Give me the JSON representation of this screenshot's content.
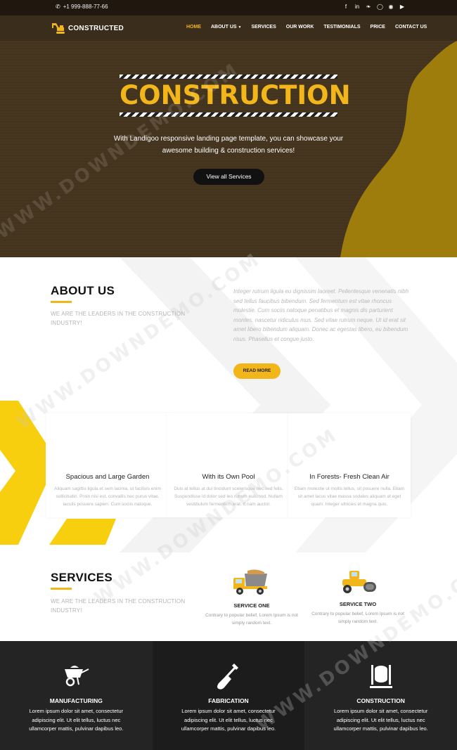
{
  "topbar": {
    "phone": "+1 999-888-77-66",
    "socials": [
      "facebook-icon",
      "linkedin-icon",
      "twitter-icon",
      "instagram-icon",
      "pinterest-icon",
      "youtube-icon"
    ]
  },
  "navbar": {
    "logo": "CONSTRUCTED",
    "items": [
      "HOME",
      "ABOUT US",
      "SERVICES",
      "OUR WORK",
      "TESTIMONIALS",
      "PRICE",
      "CONTACT US"
    ],
    "active": "HOME",
    "accent": "#f2b61a"
  },
  "hero": {
    "title": "CONSTRUCTION",
    "subtitle_line1": "With Landigoo responsive landing page template, you can showcase your",
    "subtitle_line2": "awesome building & construction services!",
    "button": "View all Services"
  },
  "about": {
    "title": "ABOUT US",
    "tagline": "WE ARE THE LEADERS IN THE CONSTRUCTION INDUSTRY!",
    "text": "Integer rutrum ligula eu dignissim laoreet. Pellentesque venenatis nibh sed tellus faucibus bibendum. Sed fermentum est vitae rhoncus molestie. Cum sociis natoque penatibus et magnis dis parturient montes, nascetur ridiculus mus. Sed vitae rutrum neque. Ut id erat sit amet libero bibendum aliquam. Donec ac egestas libero, eu bibendum risus. Phasellus et congue justo.",
    "button": "READ MORE"
  },
  "features": [
    {
      "title": "Spacious and Large Garden",
      "text": "Aliquam sagittis ligula et sem lacinia, ut facilisis enim sollicitudin. Proin nisi est, convallis nec purus vitae, iaculis posuere sapien. Cum sociis natoque."
    },
    {
      "title": "With its Own Pool",
      "text": "Duis at tellus at dui tincidunt scelerisque nec sed felis. Suspendisse id dolor sed leo rutrum euismod. Nullam vestibulum fermentum erat. It nam auctor."
    },
    {
      "title": "In Forests- Fresh Clean Air",
      "text": "Etiam molestie ut mollis tellus, sit posuere nulla. Etiam sit amet lacus vitae massa sodales aliquam at eget quam. Integer ultricies et magna quis."
    }
  ],
  "services": {
    "title": "SERVICES",
    "tagline": "WE ARE THE LEADERS IN THE CONSTRUCTION INDUSTRY!",
    "items": [
      {
        "name": "SERVICE ONE",
        "text": "Contrary to popular belief, Lorem Ipsum is not simply random text."
      },
      {
        "name": "SERVICE TWO",
        "text": "Contrary to popular belief, Lorem Ipsum is not simply random text."
      }
    ]
  },
  "band": [
    {
      "name": "MANUFACTURING",
      "text": "Lorem ipsum dolor sit amet, consectetur adipiscing elit. Ut elit tellus, luctus nec ullamcorper mattis, pulvinar dapibus leo."
    },
    {
      "name": "FABRICATION",
      "text": "Lorem ipsum dolor sit amet, consectetur adipiscing elit. Ut elit tellus, luctus nec ullamcorper mattis, pulvinar dapibus leo."
    },
    {
      "name": "CONSTRUCTION",
      "text": "Lorem ipsum dolor sit amet, consectetur adipiscing elit. Ut elit tellus, luctus nec ullamcorper mattis, pulvinar dapibus leo."
    }
  ],
  "watermark": "WWW.DOWNDEMO.COM",
  "colors": {
    "accent": "#f2b61a",
    "hero_bg": "#46361f",
    "dark_band": "#242424"
  }
}
